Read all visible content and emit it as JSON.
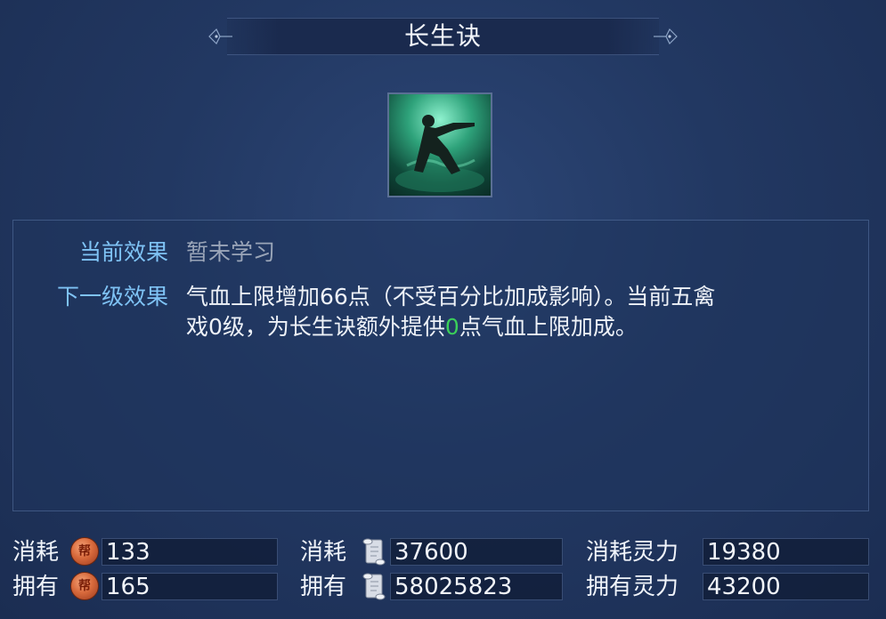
{
  "window": {
    "title": "长生诀"
  },
  "skill": {
    "icon_name": "skill-figure-icon"
  },
  "effects": {
    "current_label": "当前效果",
    "current_value": "暂未学习",
    "next_label": "下一级效果",
    "next_line1": "气血上限增加66点（不受百分比加成影响）。当前五禽",
    "next_line2_pre": "戏0级，为长生诀额外提供",
    "next_line2_highlight": "0",
    "next_line2_post": "点气血上限加成。"
  },
  "costs": {
    "col1": {
      "consume_label": "消耗",
      "consume_value": "133",
      "own_label": "拥有",
      "own_value": "165",
      "icon": "gang-coin-icon",
      "icon_glyph": "帮"
    },
    "col2": {
      "consume_label": "消耗",
      "consume_value": "37600",
      "own_label": "拥有",
      "own_value": "58025823",
      "icon": "scroll-icon"
    },
    "col3": {
      "consume_label": "消耗灵力",
      "consume_value": "19380",
      "own_label": "拥有灵力",
      "own_value": "43200"
    }
  },
  "colors": {
    "label_blue": "#7fc3f5",
    "highlight_green": "#3bd05a"
  }
}
